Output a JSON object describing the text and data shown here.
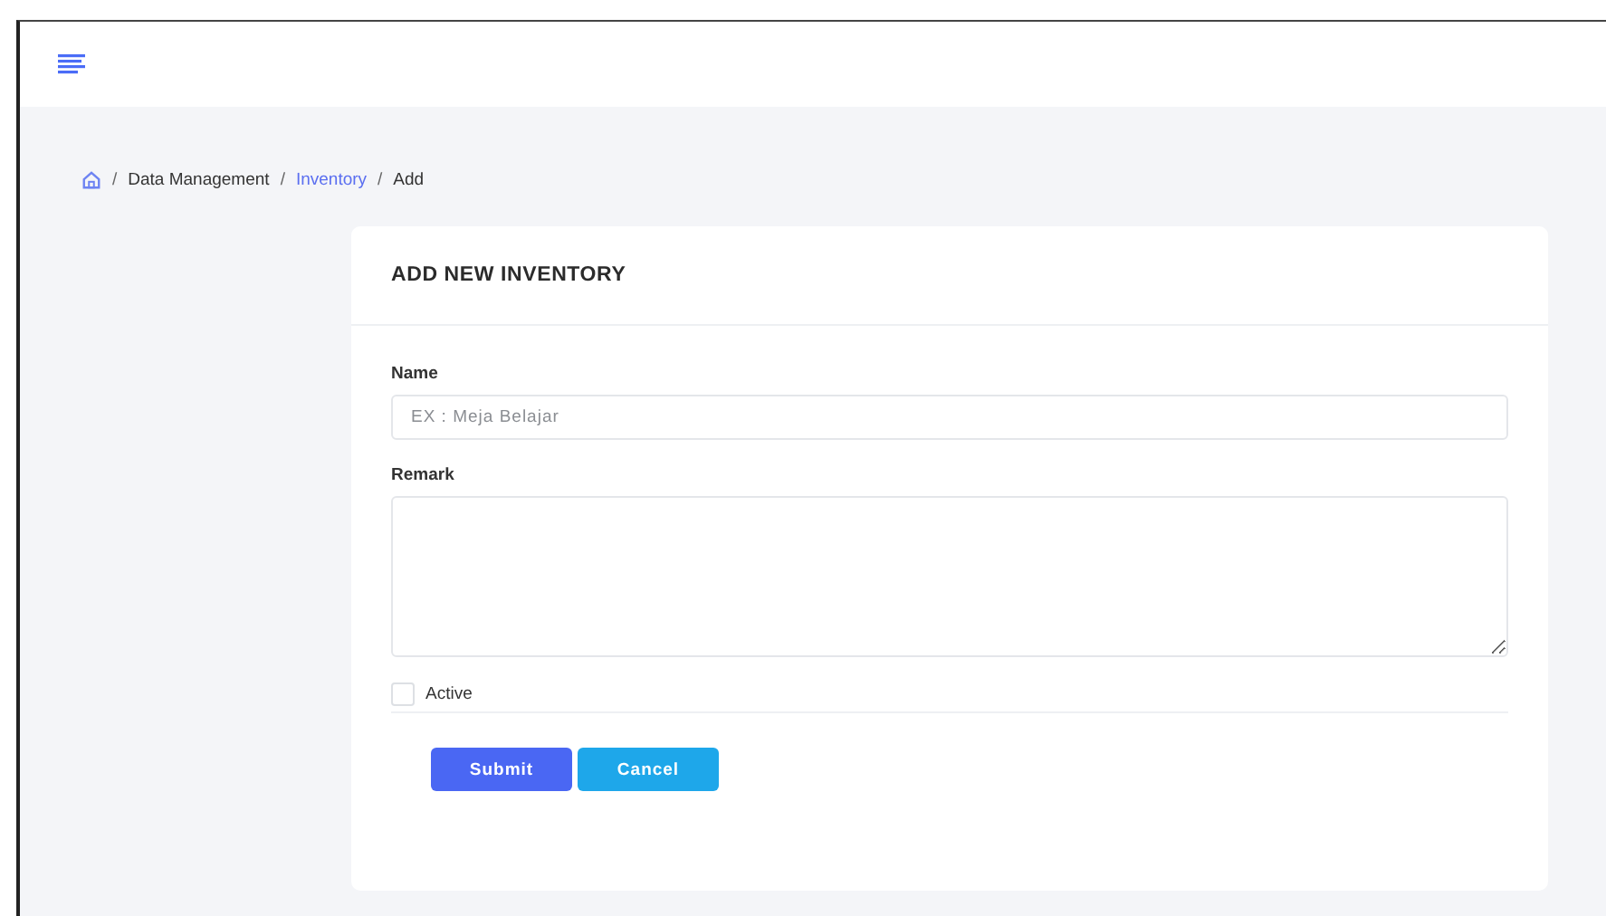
{
  "breadcrumb": [
    {
      "label": "Data Management",
      "kind": "text"
    },
    {
      "label": "Inventory",
      "kind": "link"
    },
    {
      "label": "Add",
      "kind": "text"
    }
  ],
  "breadcrumb_separator": "/",
  "card": {
    "title": "ADD NEW INVENTORY",
    "fields": [
      {
        "label": "Name",
        "kind": "input",
        "placeholder": "EX : Meja Belajar"
      },
      {
        "label": "Remark",
        "kind": "textarea"
      }
    ],
    "checkbox": {
      "label": "Active",
      "checked": false
    },
    "buttons": [
      {
        "label": "Submit",
        "kind": "primary"
      },
      {
        "label": "Cancel",
        "kind": "info"
      }
    ]
  }
}
